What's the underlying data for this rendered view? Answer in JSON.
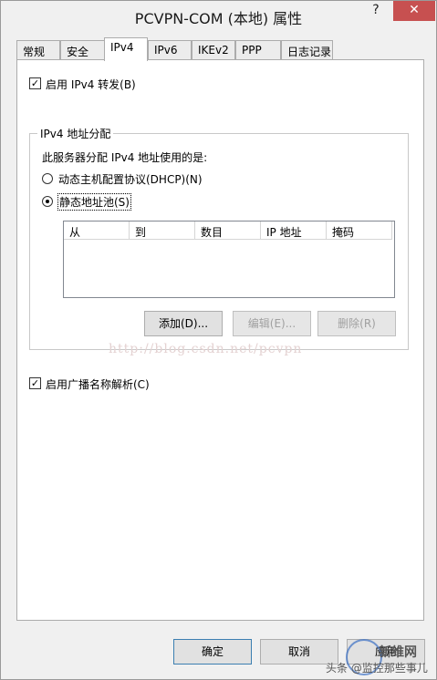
{
  "window": {
    "title": "PCVPN-COM (本地) 属性",
    "help_glyph": "?",
    "close_glyph": "✕"
  },
  "tabs": [
    "常规",
    "安全",
    "IPv4",
    "IPv6",
    "IKEv2",
    "PPP",
    "日志记录"
  ],
  "active_tab": "IPv4",
  "ipv4": {
    "enable_forwarding_label": "启用 IPv4 转发(B)",
    "enable_forwarding_checked": true,
    "group_title": "IPv4 地址分配",
    "group_prompt": "此服务器分配 IPv4 地址使用的是:",
    "radio_dhcp": "动态主机配置协议(DHCP)(N)",
    "radio_static": "静态地址池(S)",
    "selected_option": "static",
    "columns": [
      "从",
      "到",
      "数目",
      "IP 地址",
      "掩码"
    ],
    "rows": [],
    "add_button": "添加(D)...",
    "edit_button": "编辑(E)...",
    "remove_button": "删除(R)",
    "enable_broadcast_label": "启用广播名称解析(C)",
    "enable_broadcast_checked": true
  },
  "watermark": "http://blog.csdn.net/pcvpn",
  "footer": {
    "ok": "确定",
    "cancel": "取消",
    "apply": "应用"
  },
  "brand_watermark": {
    "text1": "新维网",
    "text2": "头条 @监控那些事儿"
  }
}
